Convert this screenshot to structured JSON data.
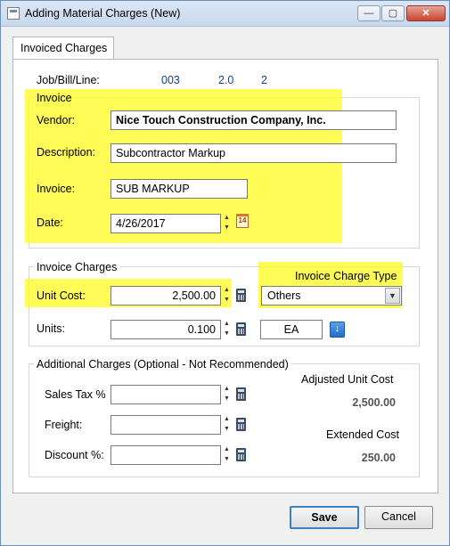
{
  "window": {
    "title": "Adding Material Charges  (New)",
    "min": "—",
    "max": "▢",
    "close": "✕"
  },
  "tab": {
    "label": "Invoiced Charges"
  },
  "job": {
    "label": "Job/Bill/Line:",
    "job": "003",
    "bill": "2.0",
    "line": "2"
  },
  "invoice_group": {
    "title": "Invoice",
    "vendor_label": "Vendor:",
    "vendor_value": "Nice Touch Construction Company, Inc.",
    "description_label": "Description:",
    "description_value": "Subcontractor Markup",
    "invoice_label": "Invoice:",
    "invoice_value": "SUB MARKUP",
    "date_label": "Date:",
    "date_value": "4/26/2017",
    "cal_day": "14"
  },
  "charges_group": {
    "title": "Invoice Charges",
    "unit_cost_label": "Unit Cost:",
    "unit_cost_value": "2,500.00",
    "units_label": "Units:",
    "units_value": "0.100",
    "type_label": "Invoice Charge Type",
    "type_value": "Others",
    "uom_value": "EA"
  },
  "additional_group": {
    "title": "Additional Charges (Optional - Not Recommended)",
    "sales_tax_label": "Sales Tax %",
    "freight_label": "Freight:",
    "discount_label": "Discount %:",
    "adjusted_label": "Adjusted Unit Cost",
    "adjusted_value": "2,500.00",
    "extended_label": "Extended Cost",
    "extended_value": "250.00"
  },
  "buttons": {
    "save": "Save",
    "cancel": "Cancel"
  },
  "colors": {
    "highlight": "#fffa3a",
    "accent_blue": "#1a3f8a"
  }
}
